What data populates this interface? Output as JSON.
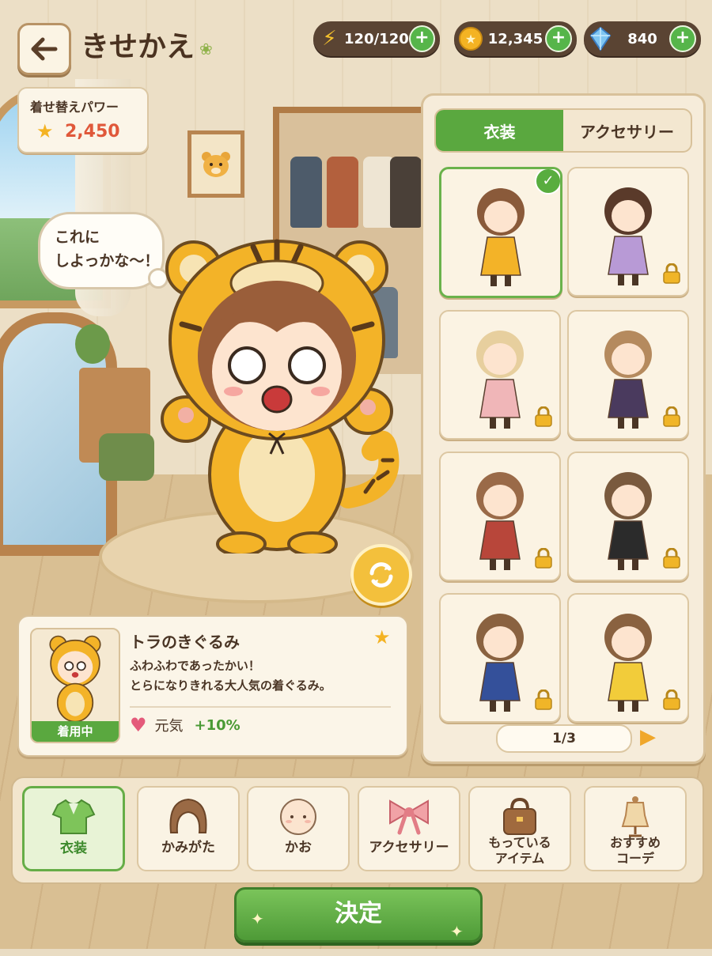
{
  "header": {
    "back_label": "←",
    "title": "きせかえ"
  },
  "resources": {
    "stamina": "120/120",
    "coins": "12,345",
    "gems": "840",
    "plus": "+"
  },
  "power": {
    "label": "着せ替えパワー",
    "value": "2,450"
  },
  "speech": {
    "line1": "これに",
    "line2": "しよっかな～！"
  },
  "panel": {
    "tabs": [
      "衣装",
      "アクセサリー"
    ],
    "active_tab": 0,
    "page": "1/3",
    "items": [
      {
        "name": "tiger-kigurumi",
        "hair": "#8a5a3a",
        "body": "#f3b328",
        "selected": true,
        "locked": false
      },
      {
        "name": "purple-jockey-outfit",
        "hair": "#5a3a2a",
        "body": "#b89ad6",
        "selected": false,
        "locked": true
      },
      {
        "name": "pink-flower-dress",
        "hair": "#e7cf9e",
        "body": "#f0b6b8",
        "selected": false,
        "locked": true
      },
      {
        "name": "witch-costume",
        "hair": "#b58a5e",
        "body": "#4a3a5e",
        "selected": false,
        "locked": true
      },
      {
        "name": "red-hood-dress",
        "hair": "#9a6a48",
        "body": "#b8463a",
        "selected": false,
        "locked": true
      },
      {
        "name": "maid-outfit",
        "hair": "#7a5a3e",
        "body": "#2b2b2b",
        "selected": false,
        "locked": true
      },
      {
        "name": "blue-winter-coat",
        "hair": "#8a6240",
        "body": "#34509a",
        "selected": false,
        "locked": true
      },
      {
        "name": "yellow-raincoat",
        "hair": "#8a6240",
        "body": "#f2cc3a",
        "selected": false,
        "locked": true
      }
    ]
  },
  "detail": {
    "name": "トラのきぐるみ",
    "desc1": "ふわふわであったかい！",
    "desc2": "とらになりきれる大人気の着ぐるみ。",
    "status": "着用中",
    "stat_label": "元気",
    "stat_value": "+10%"
  },
  "categories": [
    {
      "label": "衣装",
      "icon": "shirt-icon"
    },
    {
      "label": "かみがた",
      "icon": "hair-icon"
    },
    {
      "label": "かお",
      "icon": "face-icon"
    },
    {
      "label": "アクセサリー",
      "icon": "ribbon-icon"
    },
    {
      "label": "もっている",
      "label2": "アイテム",
      "icon": "bag-icon"
    },
    {
      "label": "おすすめ",
      "label2": "コーデ",
      "icon": "mannequin-icon"
    }
  ],
  "active_category": 0,
  "confirm_label": "決定",
  "colors": {
    "accent_green": "#5aa83f",
    "coin_gold": "#f4b323",
    "power_red": "#e0583a",
    "tiger_orange": "#f3b328"
  }
}
